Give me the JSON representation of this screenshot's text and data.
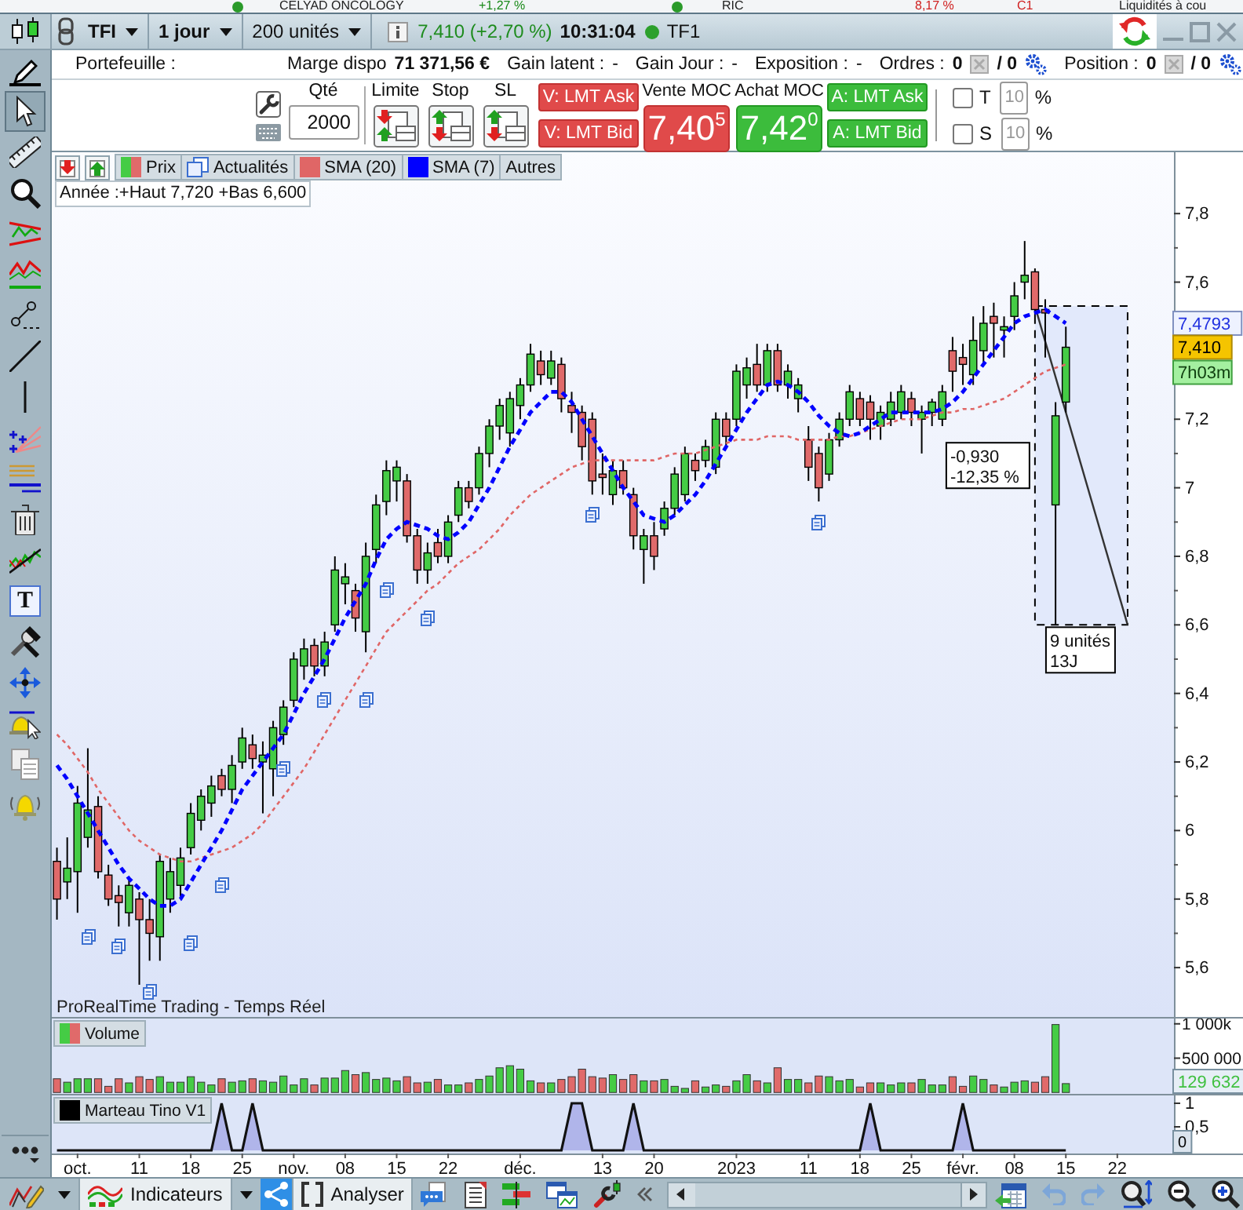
{
  "background_window": {
    "cells": [
      {
        "kind": "dot",
        "color": "#2a9a2a"
      },
      {
        "kind": "text",
        "text": "CELYAD ONCOLOGY",
        "color": "#222222"
      },
      {
        "kind": "text",
        "text": "+1,27 %",
        "color": "#1a8a1a"
      },
      {
        "kind": "dot",
        "color": "#2a9a2a"
      },
      {
        "kind": "text",
        "text": "RIC",
        "color": "#222222"
      },
      {
        "kind": "text",
        "text": "8,17 %",
        "color": "#d02020"
      },
      {
        "kind": "text",
        "text": "C1",
        "color": "#d02020"
      },
      {
        "kind": "text",
        "text": "Liquidités à cou",
        "color": "#222222"
      }
    ]
  },
  "title_bar": {
    "symbol": "TFI",
    "period": "1 jour",
    "size": "200 unités",
    "quote": "7,410 (+2,70 %)",
    "time": "10:31:04",
    "live": true,
    "name": "TF1"
  },
  "left_toolbar": {
    "tools": [
      {
        "selected": false
      },
      {
        "selected": true
      },
      {
        "selected": false
      },
      {
        "selected": false
      },
      {
        "selected": false
      },
      {
        "selected": false
      },
      {
        "selected": false
      },
      {
        "selected": false
      },
      {
        "selected": false
      },
      {
        "selected": false
      },
      {
        "selected": false
      },
      {
        "selected": false
      },
      {
        "selected": false
      },
      {
        "selected": false,
        "glyph": "T"
      },
      {
        "selected": false
      },
      {
        "selected": false
      },
      {
        "selected": false
      },
      {
        "selected": false
      },
      {
        "selected": false
      }
    ]
  },
  "account_bar": {
    "items": [
      {
        "kind": "plain",
        "label": "Portefeuille :"
      },
      {
        "kind": "amount",
        "label": "Marge dispo",
        "value": "71 371,56 €"
      },
      {
        "kind": "plain",
        "label": "Gain latent :",
        "value": "-"
      },
      {
        "kind": "plain",
        "label": "Gain Jour :",
        "value": "-"
      },
      {
        "kind": "plain",
        "label": "Exposition :",
        "value": "-"
      },
      {
        "kind": "counter",
        "label": "Ordres :",
        "value": "0",
        "total": "/ 0"
      },
      {
        "kind": "counter",
        "label": "Position :",
        "value": "0",
        "total": "/ 0"
      }
    ]
  },
  "order_panel": {
    "quantity": {
      "label": "Qté",
      "value": "2000"
    },
    "order_types": [
      {
        "label": "Limite"
      },
      {
        "label": "Stop"
      },
      {
        "label": "SL"
      }
    ],
    "sell_buttons": [
      "V: LMT Ask",
      "V: LMT Bid"
    ],
    "sell_moc": {
      "label": "Vente MOC",
      "price": "7,40$^{5}$"
    },
    "buy_moc": {
      "label": "Achat MOC",
      "price": "7,42$^{0}$"
    },
    "buy_buttons": [
      "A: LMT Ask",
      "A: LMT Bid"
    ],
    "thresholds": [
      {
        "label": "T",
        "checked": false,
        "disabled": true,
        "value": "10",
        "unit": "%"
      },
      {
        "label": "S",
        "checked": false,
        "disabled": true,
        "value": "10",
        "unit": "%"
      }
    ]
  },
  "chart": {
    "price_panel": {
      "legend": [
        {
          "kind": "price",
          "label": "Prix"
        },
        {
          "kind": "news",
          "label": "Actualités"
        },
        {
          "kind": "series"
        },
        {
          "kind": "series"
        },
        {
          "kind": "more",
          "label": "Autres"
        }
      ],
      "range_info": "Année :+Haut 7,720 +Bas 6,600",
      "feed": "ProRealTime Trading - Temps Réel",
      "value_tags": [
        {
          "kind": "average",
          "text": "7,4793"
        },
        {
          "kind": "last",
          "text": "7,410"
        },
        {
          "kind": "timer",
          "text": "7h03m"
        }
      ],
      "measure": {
        "change": "-0,930",
        "percent": "-12,35 %",
        "bars": "9 unités",
        "days": "13J"
      },
      "chart_data": {
        "type": "candlestick",
        "categories": [
          null,
          null,
          null,
          null,
          null,
          null,
          null,
          null,
          null,
          null,
          null,
          null,
          null,
          null,
          null,
          null,
          null,
          null,
          null,
          null,
          null,
          null,
          null,
          null,
          null,
          null,
          null,
          null,
          null,
          null,
          null,
          null,
          null,
          null,
          null,
          null,
          null,
          null,
          null,
          null,
          null,
          null,
          null,
          null,
          null,
          null,
          null,
          null,
          null,
          null,
          null,
          null,
          null,
          null,
          null,
          null,
          null,
          null,
          null,
          null,
          null,
          null,
          null,
          null,
          null,
          null,
          null,
          null,
          null,
          null,
          null,
          null,
          null,
          null,
          null,
          null,
          null,
          null,
          null,
          null,
          null,
          null,
          null,
          null,
          null,
          null,
          null,
          null,
          null,
          null,
          null,
          null,
          null,
          null,
          null,
          null,
          null,
          null,
          null,
          null,
          null,
          null,
          null,
          null,
          null,
          null,
          null,
          null,
          null
        ],
        "ylim": [
          5.456,
          7.979
        ],
        "yticks": [
          {
            "value": 7.8,
            "label": "7,8"
          },
          {
            "value": 7.6,
            "label": "7,6"
          },
          {
            "value": 7.2,
            "label": "7,2"
          },
          {
            "value": 7,
            "label": "7"
          },
          {
            "value": 6.8,
            "label": "6,8"
          },
          {
            "value": 6.6,
            "label": "6,6"
          },
          {
            "value": 6.4,
            "label": "6,4"
          },
          {
            "value": 6.2,
            "label": "6,2"
          },
          {
            "value": 6,
            "label": "6"
          },
          {
            "value": 5.8,
            "label": "5,8"
          },
          {
            "value": 5.6,
            "label": "5,6"
          }
        ],
        "ohlc": [
          [
            5.91,
            5.95,
            5.74,
            5.8
          ],
          [
            5.85,
            5.98,
            5.8,
            5.89
          ],
          [
            5.88,
            6.13,
            5.76,
            6.08
          ],
          [
            5.98,
            6.24,
            5.95,
            6.06
          ],
          [
            6.07,
            6.1,
            5.86,
            5.88
          ],
          [
            5.87,
            5.9,
            5.78,
            5.8
          ],
          [
            5.81,
            5.84,
            5.72,
            5.79
          ],
          [
            5.76,
            5.86,
            5.72,
            5.84
          ],
          [
            5.8,
            5.82,
            5.55,
            5.74
          ],
          [
            5.74,
            5.8,
            5.62,
            5.7
          ],
          [
            5.69,
            5.93,
            5.62,
            5.91
          ],
          [
            5.8,
            5.92,
            5.76,
            5.88
          ],
          [
            5.84,
            5.95,
            5.8,
            5.92
          ],
          [
            5.95,
            6.08,
            5.93,
            6.05
          ],
          [
            6.03,
            6.12,
            6,
            6.1
          ],
          [
            6.08,
            6.16,
            6.04,
            6.13
          ],
          [
            6.16,
            6.18,
            6.1,
            6.12
          ],
          [
            6.12,
            6.22,
            6.08,
            6.19
          ],
          [
            6.2,
            6.3,
            6.18,
            6.27
          ],
          [
            6.25,
            6.28,
            6.18,
            6.21
          ],
          [
            6.2,
            6.26,
            6.05,
            6.22
          ],
          [
            6.18,
            6.32,
            6.1,
            6.3
          ],
          [
            6.28,
            6.38,
            6.25,
            6.36
          ],
          [
            6.38,
            6.52,
            6.36,
            6.5
          ],
          [
            6.48,
            6.56,
            6.44,
            6.53
          ],
          [
            6.54,
            6.56,
            6.45,
            6.48
          ],
          [
            6.48,
            6.58,
            6.45,
            6.55
          ],
          [
            6.6,
            6.8,
            6.58,
            6.76
          ],
          [
            6.72,
            6.78,
            6.66,
            6.74
          ],
          [
            6.7,
            6.72,
            6.58,
            6.62
          ],
          [
            6.58,
            6.84,
            6.52,
            6.8
          ],
          [
            6.82,
            6.98,
            6.78,
            6.95
          ],
          [
            6.96,
            7.08,
            6.92,
            7.05
          ],
          [
            7.02,
            7.08,
            6.96,
            7.06
          ],
          [
            7.02,
            7.04,
            6.84,
            6.86
          ],
          [
            6.86,
            6.88,
            6.72,
            6.76
          ],
          [
            6.76,
            6.84,
            6.72,
            6.81
          ],
          [
            6.84,
            6.88,
            6.78,
            6.8
          ],
          [
            6.8,
            6.92,
            6.78,
            6.9
          ],
          [
            6.92,
            7.02,
            6.9,
            7
          ],
          [
            7,
            7.02,
            6.94,
            6.96
          ],
          [
            7,
            7.12,
            6.98,
            7.1
          ],
          [
            7.1,
            7.2,
            7.06,
            7.18
          ],
          [
            7.18,
            7.26,
            7.14,
            7.24
          ],
          [
            7.16,
            7.28,
            7.12,
            7.26
          ],
          [
            7.24,
            7.32,
            7.2,
            7.3
          ],
          [
            7.3,
            7.42,
            7.28,
            7.39
          ],
          [
            7.37,
            7.4,
            7.3,
            7.33
          ],
          [
            7.32,
            7.4,
            7.3,
            7.37
          ],
          [
            7.36,
            7.38,
            7.22,
            7.26
          ],
          [
            7.24,
            7.28,
            7.16,
            7.22
          ],
          [
            7.22,
            7.24,
            7.08,
            7.12
          ],
          [
            7.2,
            7.22,
            6.98,
            7.02
          ],
          [
            7.04,
            7.1,
            6.98,
            7.03
          ],
          [
            6.98,
            7.08,
            6.95,
            7.05
          ],
          [
            7.05,
            7.08,
            6.98,
            7
          ],
          [
            6.98,
            7,
            6.82,
            6.86
          ],
          [
            6.82,
            6.88,
            6.72,
            6.86
          ],
          [
            6.86,
            6.9,
            6.76,
            6.8
          ],
          [
            6.88,
            6.96,
            6.86,
            6.94
          ],
          [
            6.94,
            7.06,
            6.92,
            7.04
          ],
          [
            6.98,
            7.12,
            6.96,
            7.1
          ],
          [
            7.08,
            7.1,
            7.02,
            7.05
          ],
          [
            7.08,
            7.14,
            7.06,
            7.12
          ],
          [
            7.06,
            7.22,
            7.04,
            7.2
          ],
          [
            7.2,
            7.22,
            7.12,
            7.15
          ],
          [
            7.2,
            7.36,
            7.18,
            7.34
          ],
          [
            7.3,
            7.38,
            7.26,
            7.35
          ],
          [
            7.36,
            7.42,
            7.28,
            7.3
          ],
          [
            7.3,
            7.42,
            7.28,
            7.4
          ],
          [
            7.4,
            7.42,
            7.28,
            7.3
          ],
          [
            7.3,
            7.36,
            7.26,
            7.34
          ],
          [
            7.26,
            7.32,
            7.22,
            7.3
          ],
          [
            7.14,
            7.18,
            7.02,
            7.06
          ],
          [
            7.1,
            7.12,
            6.96,
            7
          ],
          [
            7.04,
            7.16,
            7.02,
            7.14
          ],
          [
            7.14,
            7.22,
            7.12,
            7.2
          ],
          [
            7.2,
            7.3,
            7.18,
            7.28
          ],
          [
            7.26,
            7.28,
            7.18,
            7.2
          ],
          [
            7.25,
            7.27,
            7.14,
            7.2
          ],
          [
            7.18,
            7.24,
            7.14,
            7.22
          ],
          [
            7.2,
            7.28,
            7.18,
            7.25
          ],
          [
            7.22,
            7.3,
            7.2,
            7.28
          ],
          [
            7.26,
            7.28,
            7.18,
            7.22
          ],
          [
            7.2,
            7.24,
            7.1,
            7.22
          ],
          [
            7.22,
            7.26,
            7.18,
            7.25
          ],
          [
            7.2,
            7.3,
            7.18,
            7.28
          ],
          [
            7.4,
            7.44,
            7.28,
            7.34
          ],
          [
            7.38,
            7.42,
            7.3,
            7.36
          ],
          [
            7.33,
            7.5,
            7.3,
            7.43
          ],
          [
            7.4,
            7.53,
            7.36,
            7.48
          ],
          [
            7.5,
            7.54,
            7.38,
            7.48
          ],
          [
            7.46,
            7.5,
            7.38,
            7.47
          ],
          [
            7.5,
            7.6,
            7.46,
            7.56
          ],
          [
            7.6,
            7.72,
            7.55,
            7.62
          ],
          [
            7.63,
            7.64,
            7.5,
            7.52
          ],
          [
            7.52,
            7.55,
            7.38,
            7.51
          ],
          [
            6.95,
            7.25,
            6.6,
            7.21
          ],
          [
            7.25,
            7.47,
            7.22,
            7.41
          ],
          null,
          null,
          null,
          null,
          null,
          null,
          null,
          null,
          null,
          null
        ],
        "series": [
          {
            "type": "line",
            "name": "SMA (20)",
            "color": "#e06666",
            "line_style": "dotted",
            "values": [
              6.28,
              6.25,
              6.21,
              6.17,
              6.12,
              6.08,
              6.04,
              6,
              5.97,
              5.95,
              5.93,
              5.92,
              5.91,
              5.91,
              5.92,
              5.93,
              5.94,
              5.95,
              5.97,
              5.99,
              6.02,
              6.06,
              6.1,
              6.14,
              6.18,
              6.23,
              6.28,
              6.33,
              6.38,
              6.43,
              6.48,
              6.53,
              6.58,
              6.61,
              6.64,
              6.67,
              6.7,
              6.72,
              6.75,
              6.78,
              6.8,
              6.82,
              6.85,
              6.88,
              6.92,
              6.95,
              6.98,
              7,
              7.02,
              7.04,
              7.06,
              7.07,
              7.08,
              7.08,
              7.08,
              7.08,
              7.08,
              7.08,
              7.08,
              7.09,
              7.1,
              7.1,
              7.1,
              7.11,
              7.12,
              7.13,
              7.14,
              7.14,
              7.14,
              7.15,
              7.15,
              7.15,
              7.14,
              7.14,
              7.14,
              7.14,
              7.15,
              7.15,
              7.16,
              7.17,
              7.18,
              7.19,
              7.2,
              7.2,
              7.2,
              7.21,
              7.22,
              7.22,
              7.23,
              7.23,
              7.24,
              7.25,
              7.26,
              7.28,
              7.3,
              7.32,
              7.34,
              7.35,
              7.36,
              null,
              null,
              null,
              null,
              null,
              null,
              null,
              null,
              null,
              null
            ]
          },
          {
            "type": "line",
            "name": "SMA (7)",
            "color": "#0000ff",
            "line_style": "dashed",
            "values": [
              6.19,
              6.15,
              6.1,
              6.05,
              6,
              5.95,
              5.9,
              5.86,
              5.83,
              5.8,
              5.78,
              5.78,
              5.8,
              5.85,
              5.9,
              5.95,
              6,
              6.06,
              6.12,
              6.16,
              6.2,
              6.24,
              6.28,
              6.34,
              6.4,
              6.45,
              6.5,
              6.56,
              6.62,
              6.67,
              6.72,
              6.79,
              6.85,
              6.88,
              6.9,
              6.89,
              6.88,
              6.86,
              6.85,
              6.87,
              6.9,
              6.95,
              7,
              7.06,
              7.12,
              7.17,
              7.22,
              7.25,
              7.28,
              7.28,
              7.25,
              7.2,
              7.15,
              7.1,
              7.05,
              7,
              6.96,
              6.92,
              6.91,
              6.9,
              6.92,
              6.95,
              6.98,
              7.02,
              7.07,
              7.12,
              7.17,
              7.22,
              7.26,
              7.3,
              7.31,
              7.3,
              7.28,
              7.25,
              7.21,
              7.18,
              7.16,
              7.15,
              7.16,
              7.18,
              7.2,
              7.22,
              7.22,
              7.22,
              7.22,
              7.22,
              7.23,
              7.25,
              7.28,
              7.32,
              7.36,
              7.4,
              7.44,
              7.48,
              7.5,
              7.51,
              7.52,
              7.5,
              7.48,
              null,
              null,
              null,
              null,
              null,
              null,
              null,
              null,
              null,
              null
            ]
          }
        ]
      }
    },
    "volume_panel": {
      "value_tags": [
        {
          "kind": "last",
          "text": "129 632"
        }
      ],
      "chart_data": {
        "type": "bar",
        "categories": [
          null,
          null,
          null,
          null,
          null,
          null,
          null,
          null,
          null,
          null,
          null,
          null,
          null,
          null,
          null,
          null,
          null,
          null,
          null,
          null,
          null,
          null,
          null,
          null,
          null,
          null,
          null,
          null,
          null,
          null,
          null,
          null,
          null,
          null,
          null,
          null,
          null,
          null,
          null,
          null,
          null,
          null,
          null,
          null,
          null,
          null,
          null,
          null,
          null,
          null,
          null,
          null,
          null,
          null,
          null,
          null,
          null,
          null,
          null,
          null,
          null,
          null,
          null,
          null,
          null,
          null,
          null,
          null,
          null,
          null,
          null,
          null,
          null,
          null,
          null,
          null,
          null,
          null,
          null,
          null,
          null,
          null,
          null,
          null,
          null,
          null,
          null,
          null,
          null,
          null,
          null,
          null,
          null,
          null,
          null,
          null,
          null,
          null,
          null,
          null,
          null,
          null,
          null,
          null,
          null,
          null,
          null,
          null,
          null
        ],
        "ylim": [
          -20000,
          1100000
        ],
        "yticks": [
          {
            "value": 1000000,
            "label": "1 000k"
          },
          {
            "value": 500000,
            "label": "500 000"
          }
        ],
        "series": [
          {
            "name": "Volume",
            "values": [
              200000,
              150000,
              200000,
              200000,
              200000,
              90000,
              200000,
              140000,
              230000,
              190000,
              230000,
              150000,
              150000,
              230000,
              150000,
              110000,
              200000,
              150000,
              170000,
              200000,
              170000,
              150000,
              240000,
              110000,
              200000,
              110000,
              210000,
              210000,
              320000,
              260000,
              290000,
              190000,
              210000,
              170000,
              230000,
              140000,
              150000,
              190000,
              110000,
              110000,
              140000,
              190000,
              240000,
              360000,
              390000,
              340000,
              170000,
              140000,
              140000,
              190000,
              230000,
              340000,
              230000,
              210000,
              260000,
              190000,
              260000,
              170000,
              170000,
              190000,
              90000,
              60000,
              170000,
              80000,
              110000,
              90000,
              170000,
              260000,
              170000,
              140000,
              360000,
              190000,
              190000,
              140000,
              240000,
              230000,
              170000,
              190000,
              80000,
              140000,
              140000,
              110000,
              140000,
              140000,
              190000,
              110000,
              110000,
              230000,
              90000,
              240000,
              190000,
              110000,
              80000,
              150000,
              170000,
              150000,
              230000,
              990000,
              129632,
              null,
              null,
              null,
              null,
              null,
              null,
              null,
              null,
              null,
              null
            ]
          }
        ]
      }
    },
    "indicator_panel": {
      "value_tags": [
        {
          "kind": "last",
          "text": "0"
        }
      ],
      "chart_data": {
        "type": "area",
        "categories": [
          null,
          null,
          "oct.",
          null,
          null,
          null,
          null,
          null,
          "11",
          null,
          null,
          null,
          null,
          "18",
          null,
          null,
          null,
          null,
          "25",
          null,
          null,
          null,
          null,
          "nov.",
          null,
          null,
          null,
          null,
          "08",
          null,
          null,
          null,
          null,
          "15",
          null,
          null,
          null,
          null,
          "22",
          null,
          null,
          null,
          null,
          null,
          null,
          "déc.",
          null,
          null,
          null,
          null,
          null,
          null,
          null,
          "13",
          null,
          null,
          null,
          null,
          "20",
          null,
          null,
          null,
          null,
          null,
          null,
          null,
          "2023",
          null,
          null,
          null,
          null,
          null,
          null,
          "11",
          null,
          null,
          null,
          null,
          "18",
          null,
          null,
          null,
          null,
          "25",
          null,
          null,
          null,
          null,
          "févr.",
          null,
          null,
          null,
          null,
          "08",
          null,
          null,
          null,
          null,
          "15",
          null,
          null,
          null,
          null,
          "22",
          null,
          null,
          null,
          null,
          null
        ],
        "ylim": [
          -0.067,
          1.2
        ],
        "yticks": [
          {
            "value": 1,
            "label": "1"
          },
          {
            "value": 0.5,
            "label": "0,5"
          }
        ],
        "series": [
          {
            "name": "Marteau Tino V1",
            "values": [
              0,
              0,
              0,
              0,
              0,
              0,
              0,
              0,
              0,
              0,
              0,
              0,
              0,
              0,
              0,
              0,
              1,
              0,
              0,
              1,
              0,
              0,
              0,
              0,
              0,
              0,
              0,
              0,
              0,
              0,
              0,
              0,
              0,
              0,
              0,
              0,
              0,
              0,
              0,
              0,
              0,
              0,
              0,
              0,
              0,
              0,
              0,
              0,
              0,
              0,
              1,
              1,
              0,
              0,
              0,
              0,
              1,
              0,
              0,
              0,
              0,
              0,
              0,
              0,
              0,
              0,
              0,
              0,
              0,
              0,
              0,
              0,
              0,
              0,
              0,
              0,
              0,
              0,
              0,
              1,
              0,
              0,
              0,
              0,
              0,
              0,
              0,
              0,
              1,
              0,
              0,
              0,
              0,
              0,
              0,
              0,
              0,
              0,
              0,
              null,
              null,
              null,
              null,
              null,
              null,
              null,
              null,
              null,
              null
            ]
          }
        ]
      }
    }
  },
  "bottom_toolbar": {
    "indicators": "Indicateurs",
    "analyse": "Analyser"
  }
}
